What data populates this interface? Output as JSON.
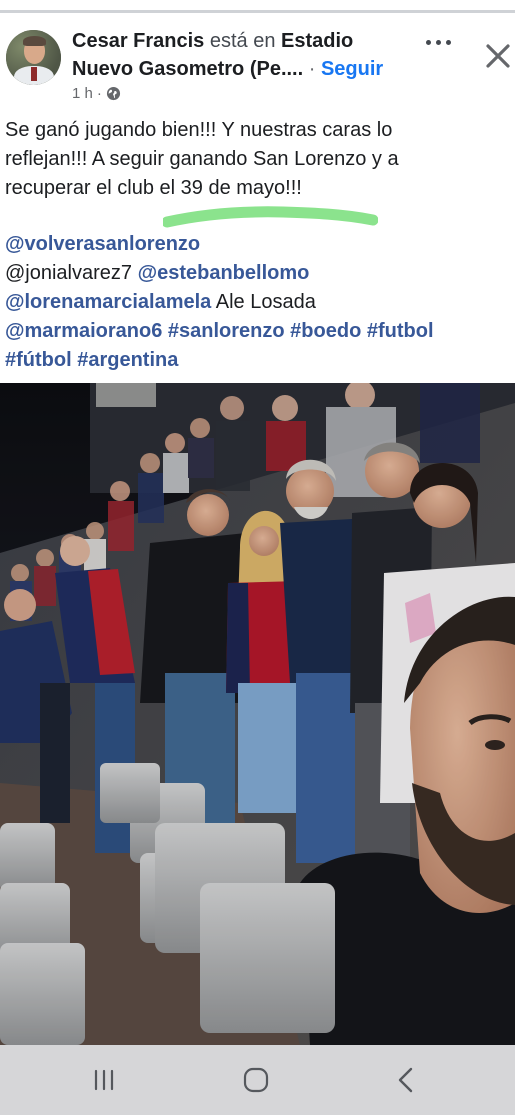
{
  "post": {
    "author": "Cesar Francis",
    "verb": "está en",
    "place": "Estadio Nuevo Gasometro (Pe....",
    "separator": "·",
    "follow_label": "Seguir",
    "time": "1 h",
    "meta_separator": "·",
    "privacy_icon": "globe-icon",
    "more_icon": "more-options-icon",
    "close_icon": "close-icon",
    "body_lines": [
      "Se ganó jugando bien!!! Y nuestras caras lo",
      "reflejan!!! A seguir ganando San Lorenzo y a",
      "recuperar el club el 39 de mayo!!!"
    ],
    "highlight_color": "#7ee081",
    "mentions_lines": [
      [
        {
          "text": "@volverasanlorenzo",
          "link": true
        }
      ],
      [
        {
          "text": "@jonialvarez7 ",
          "link": false
        },
        {
          "text": "@estebanbellomo",
          "link": true
        }
      ],
      [
        {
          "text": "@lorenamarcialamela",
          "link": true
        },
        {
          "text": " Ale Losada",
          "link": false
        }
      ],
      [
        {
          "text": "@marmaiorano6",
          "link": true
        },
        {
          "text": " ",
          "link": false
        },
        {
          "text": "#sanlorenzo",
          "link": true
        },
        {
          "text": " ",
          "link": false
        },
        {
          "text": "#boedo",
          "link": true
        },
        {
          "text": " ",
          "link": false
        },
        {
          "text": "#futbol",
          "link": true
        }
      ],
      [
        {
          "text": "#fútbol",
          "link": true
        },
        {
          "text": " ",
          "link": false
        },
        {
          "text": "#argentina",
          "link": true
        }
      ]
    ]
  },
  "colors": {
    "link": "#385898",
    "follow": "#1877f2",
    "secondary_text": "#65676b",
    "club_red": "#b3202a",
    "club_blue": "#1d2c5e"
  },
  "navbar": {
    "recents_icon": "recent-apps-icon",
    "home_icon": "home-icon",
    "back_icon": "back-icon"
  }
}
